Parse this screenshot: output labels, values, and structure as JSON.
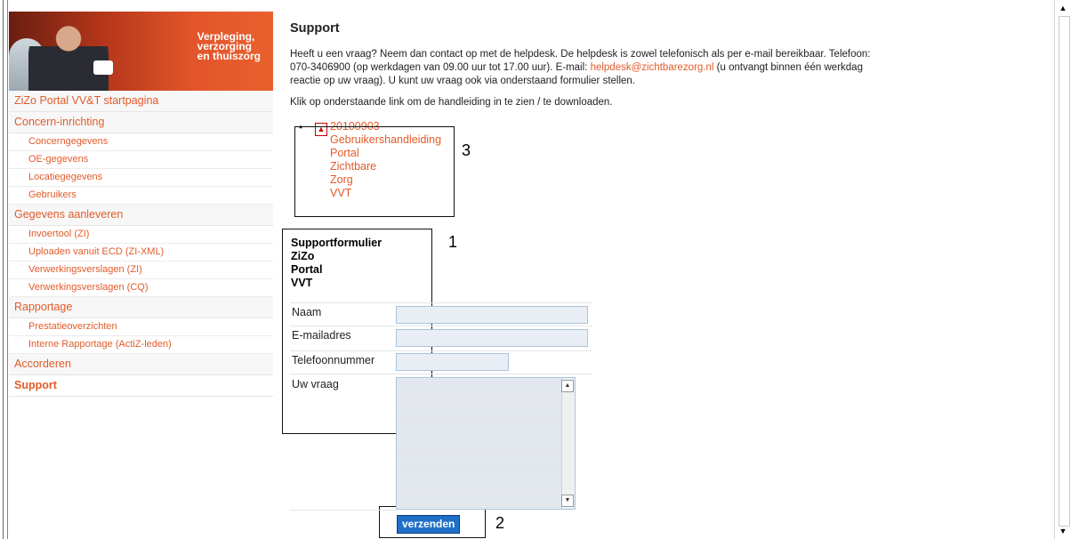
{
  "sidebar": {
    "banner_tagline": [
      "Verpleging,",
      "verzorging",
      "en thuiszorg"
    ],
    "startpage": "ZiZo Portal VV&T startpagina",
    "sections": [
      {
        "label": "Concern-inrichting",
        "items": [
          "Concerngegevens",
          "OE-gegevens",
          "Locatiegegevens",
          "Gebruikers"
        ]
      },
      {
        "label": "Gegevens aanleveren",
        "items": [
          "Invoertool (ZI)",
          "Uploaden vanuit ECD (ZI-XML)",
          "Verwerkingsverslagen (ZI)",
          "Verwerkingsverslagen (CQ)"
        ]
      },
      {
        "label": "Rapportage",
        "items": [
          "Prestatieoverzichten",
          "Interne Rapportage (ActiZ-leden)"
        ]
      },
      {
        "label": "Accorderen",
        "items": []
      }
    ],
    "active": "Support"
  },
  "main": {
    "title": "Support",
    "intro_1": "Heeft u een vraag? Neem dan contact op met de helpdesk. De helpdesk is zowel telefonisch als per e-mail bereikbaar. Telefoon:",
    "intro_2": "070-3406900 (op werkdagen van 09.00 uur tot 17.00 uur). E-mail:",
    "email": "helpdesk@zichtbarezorg.nl",
    "intro_3": "(u ontvangt binnen één werkdag",
    "intro_4": "reactie op uw vraag). U kunt uw vraag ook via onderstaand formulier stellen.",
    "manual_text": "Klik op onderstaande link om de handleiding in te zien / te downloaden.",
    "doc_lines": [
      "20100903",
      "Gebruikershandleiding",
      "Portal",
      "Zichtbare",
      "Zorg",
      "VVT"
    ]
  },
  "form": {
    "title_lines": [
      "Supportformulier",
      "ZiZo",
      "Portal",
      "VVT"
    ],
    "name_label": "Naam",
    "email_label": "E-mailadres",
    "phone_label": "Telefoonnummer",
    "question_label": "Uw vraag",
    "submit_label": "verzenden"
  },
  "annotations": {
    "n1": "1",
    "n2": "2",
    "n3": "3"
  }
}
